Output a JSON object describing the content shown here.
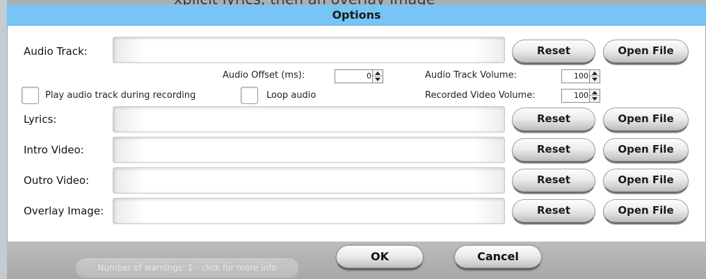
{
  "background_app": {
    "partial_text": "xplicit lyrics, then an overlay image"
  },
  "dialog": {
    "title": "Options"
  },
  "rows": {
    "audio_track": {
      "label": "Audio Track:",
      "value": "",
      "reset": "Reset",
      "open": "Open File"
    },
    "lyrics": {
      "label": "Lyrics:",
      "value": "",
      "reset": "Reset",
      "open": "Open File"
    },
    "intro_video": {
      "label": "Intro Video:",
      "value": "",
      "reset": "Reset",
      "open": "Open File"
    },
    "outro_video": {
      "label": "Outro Video:",
      "value": "",
      "reset": "Reset",
      "open": "Open File"
    },
    "overlay_image": {
      "label": "Overlay Image:",
      "value": "",
      "reset": "Reset",
      "open": "Open File"
    }
  },
  "audio_options": {
    "offset_label": "Audio Offset (ms):",
    "offset_value": "0",
    "track_volume_label": "Audio Track Volume:",
    "track_volume_value": "100",
    "recorded_volume_label": "Recorded Video Volume:",
    "recorded_volume_value": "100",
    "play_during_recording_label": "Play audio track during recording",
    "play_during_recording_checked": false,
    "loop_audio_label": "Loop audio",
    "loop_audio_checked": false
  },
  "footer": {
    "ok_label": "OK",
    "cancel_label": "Cancel",
    "warnings_label": "Number of warnings: 1 - click for more info"
  },
  "colors": {
    "titlebar": "#76c5f5",
    "footer": "#b0b0b0",
    "dialog_bg": "#ffffff"
  }
}
